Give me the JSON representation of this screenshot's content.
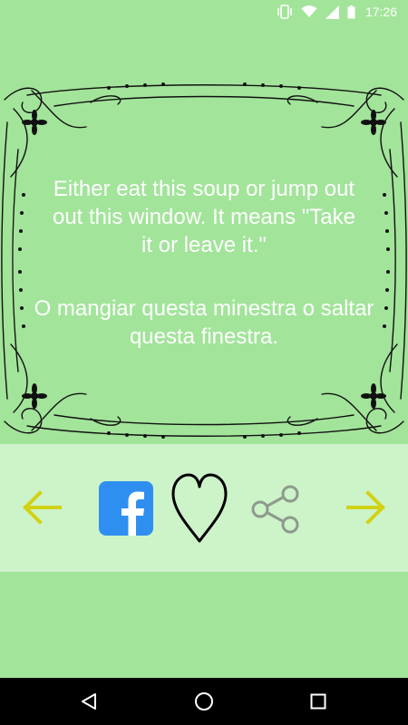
{
  "status_bar": {
    "time": "17:26",
    "icons": [
      "vibrate-icon",
      "wifi-icon",
      "signal-icon",
      "battery-icon"
    ]
  },
  "quote": {
    "english": "Either eat this soup or jump out\nout this window. It means \"Take\nit or leave it.\"",
    "italian": "O mangiar questa minestra o saltar\nquesta finestra."
  },
  "actions": {
    "previous": "arrow-left-icon",
    "facebook": "facebook-icon",
    "favorite": "heart-icon",
    "share": "share-icon",
    "next": "arrow-right-icon"
  },
  "colors": {
    "background": "#a2e49a",
    "action_bar": "#cdf3c9",
    "arrow": "#d2d214",
    "facebook": "#2f8ff0",
    "text": "#ffffff"
  },
  "nav_bar": {
    "buttons": [
      "back-icon",
      "home-icon",
      "recents-icon"
    ]
  }
}
